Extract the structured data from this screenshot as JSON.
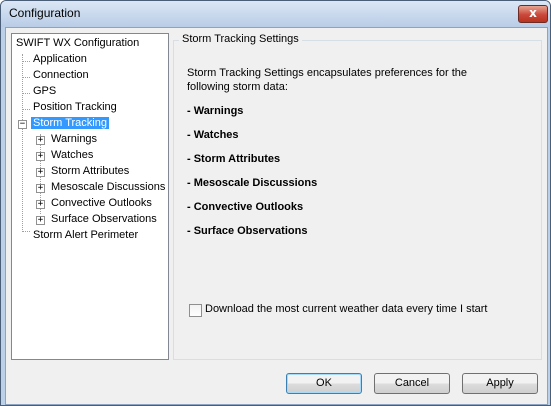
{
  "window": {
    "title": "Configuration",
    "close_glyph": "x"
  },
  "tree": {
    "root": "SWIFT WX Configuration",
    "items": [
      {
        "label": "Application"
      },
      {
        "label": "Connection"
      },
      {
        "label": "GPS"
      },
      {
        "label": "Position Tracking"
      },
      {
        "label": "Storm Tracking",
        "selected": true,
        "expanded": true,
        "children": [
          "Warnings",
          "Watches",
          "Storm Attributes",
          "Mesoscale Discussions",
          "Convective Outlooks",
          "Surface Observations"
        ]
      },
      {
        "label": "Storm Alert Perimeter"
      }
    ],
    "expander_expanded": "−",
    "expander_collapsed": "+"
  },
  "panel": {
    "caption": "Storm Tracking Settings",
    "intro": "Storm Tracking Settings encapsulates preferences for the following storm data:",
    "bullets": [
      "- Warnings",
      "- Watches",
      "- Storm Attributes",
      "- Mesoscale Discussions",
      "- Convective Outlooks",
      "- Surface Observations"
    ],
    "checkbox_label": "Download the most current weather data every time I start",
    "checkbox_checked": false
  },
  "buttons": {
    "ok": "OK",
    "cancel": "Cancel",
    "apply": "Apply"
  }
}
